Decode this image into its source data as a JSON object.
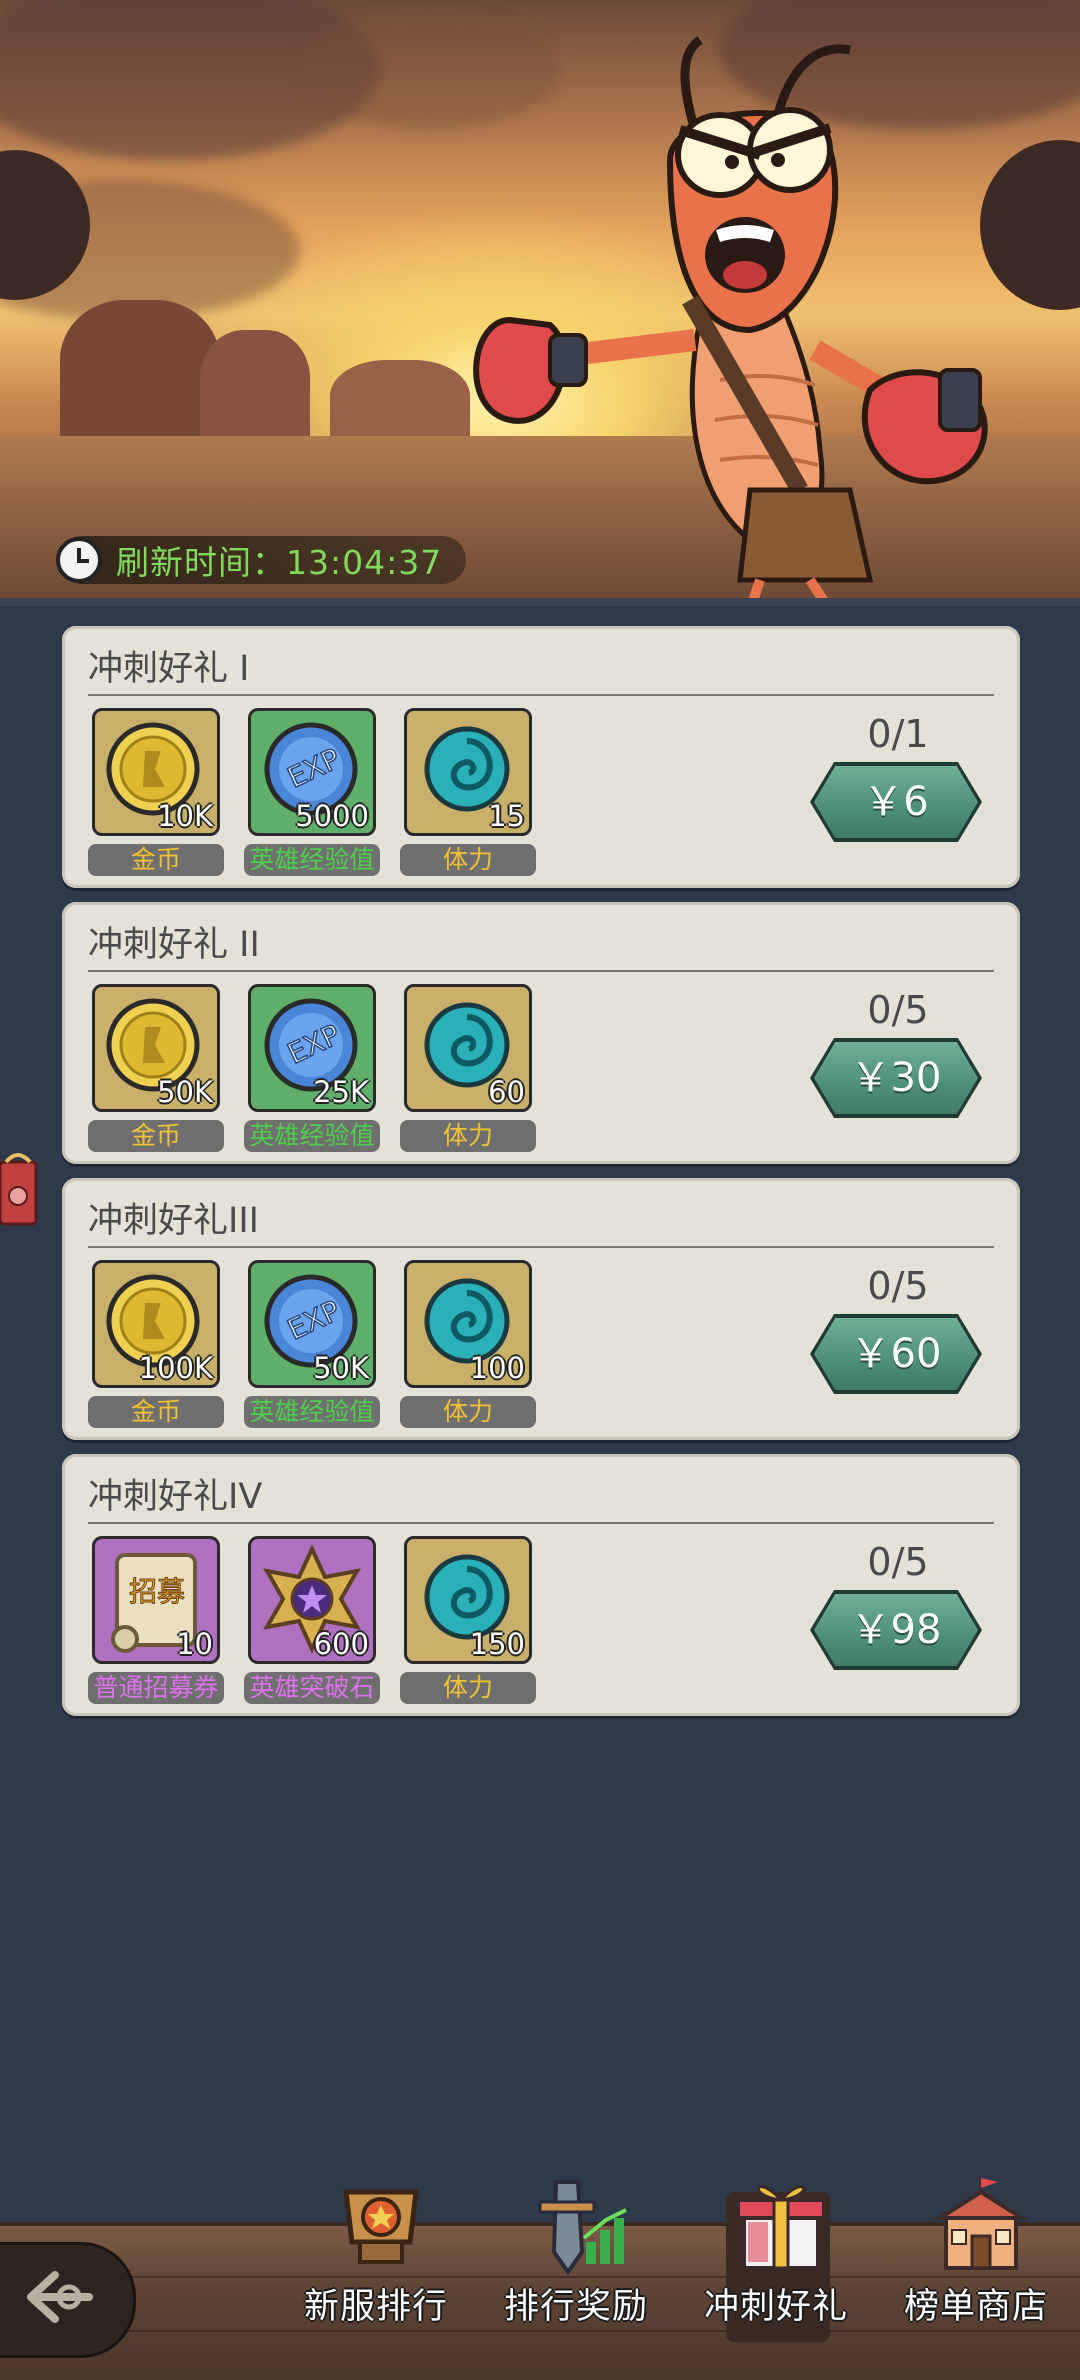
{
  "banner": {
    "refresh_text": "刷新时间：13:04:37"
  },
  "gifts": [
    {
      "title": "冲刺好礼 I",
      "count": "0/1",
      "price": "￥6",
      "items": [
        {
          "name": "金币",
          "qty": "10K",
          "icon": "gold-coin-icon"
        },
        {
          "name": "英雄经验值",
          "qty": "5000",
          "icon": "exp-coin-icon"
        },
        {
          "name": "体力",
          "qty": "15",
          "icon": "stamina-swirl-icon"
        }
      ]
    },
    {
      "title": "冲刺好礼 II",
      "count": "0/5",
      "price": "￥30",
      "items": [
        {
          "name": "金币",
          "qty": "50K",
          "icon": "gold-coin-icon"
        },
        {
          "name": "英雄经验值",
          "qty": "25K",
          "icon": "exp-coin-icon"
        },
        {
          "name": "体力",
          "qty": "60",
          "icon": "stamina-swirl-icon"
        }
      ]
    },
    {
      "title": "冲刺好礼III",
      "count": "0/5",
      "price": "￥60",
      "items": [
        {
          "name": "金币",
          "qty": "100K",
          "icon": "gold-coin-icon"
        },
        {
          "name": "英雄经验值",
          "qty": "50K",
          "icon": "exp-coin-icon"
        },
        {
          "name": "体力",
          "qty": "100",
          "icon": "stamina-swirl-icon"
        }
      ]
    },
    {
      "title": "冲刺好礼IV",
      "count": "0/5",
      "price": "￥98",
      "items": [
        {
          "name": "普通招募券",
          "qty": "10",
          "icon": "recruit-scroll-icon",
          "badge": "招募"
        },
        {
          "name": "英雄突破石",
          "qty": "600",
          "icon": "breakthrough-star-icon"
        },
        {
          "name": "体力",
          "qty": "150",
          "icon": "stamina-swirl-icon"
        }
      ]
    }
  ],
  "nav": {
    "items": [
      {
        "label": "新服排行",
        "icon": "trophy-icon"
      },
      {
        "label": "排行奖励",
        "icon": "sword-chart-icon"
      },
      {
        "label": "冲刺好礼",
        "icon": "gift-box-icon"
      },
      {
        "label": "榜单商店",
        "icon": "shop-building-icon"
      }
    ]
  },
  "colors": {
    "page_bg": "#2e3a4c",
    "card_bg": "#e4e1d7",
    "price_button": "#4c8f77",
    "refresh_text": "#7fdc5a"
  }
}
